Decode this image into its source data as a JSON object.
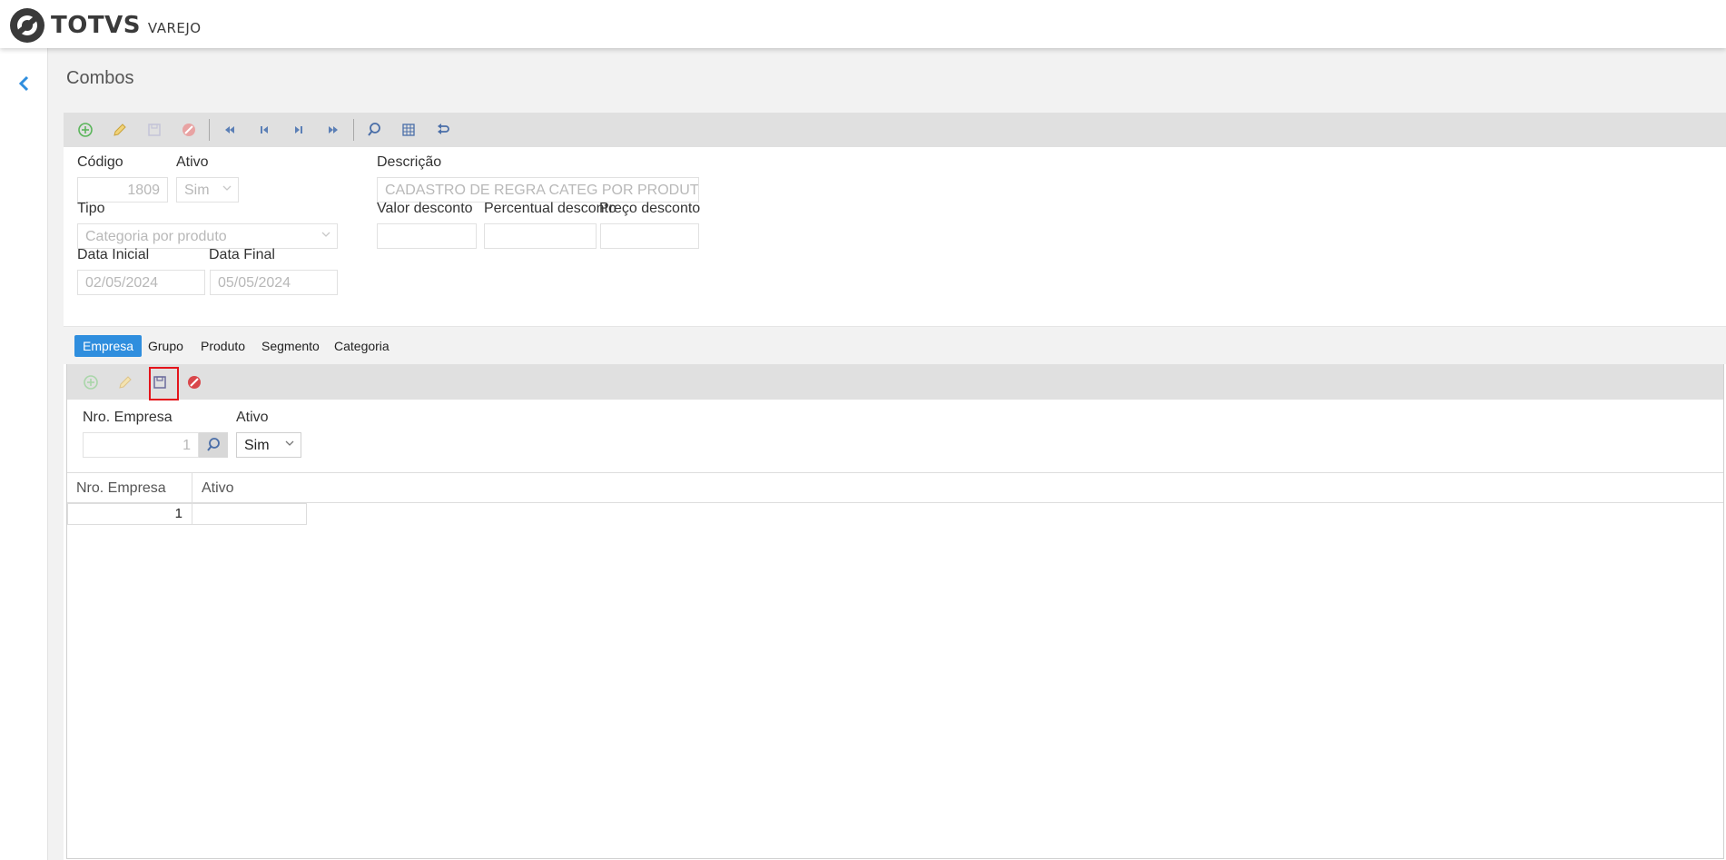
{
  "app": {
    "brand": "TOTVS",
    "product": "VAREJO"
  },
  "page": {
    "title": "Combos"
  },
  "toolbar": {
    "buttons": [
      "add-icon",
      "edit-icon",
      "save-icon",
      "cancel-icon",
      "first-icon",
      "previous-icon",
      "next-icon",
      "last-icon",
      "search-icon",
      "grid-icon",
      "undo-icon"
    ]
  },
  "form": {
    "codigo": {
      "label": "Código",
      "value": "1809"
    },
    "ativo": {
      "label": "Ativo",
      "value": "Sim"
    },
    "descricao": {
      "label": "Descrição",
      "value": "CADASTRO DE REGRA CATEG POR PRODUTO"
    },
    "tipo": {
      "label": "Tipo",
      "value": "Categoria por produto"
    },
    "valor_desconto": {
      "label": "Valor desconto",
      "value": ""
    },
    "percentual_desconto": {
      "label": "Percentual desconto",
      "value": ""
    },
    "preco_desconto": {
      "label": "Preço desconto",
      "value": ""
    },
    "data_inicial": {
      "label": "Data Inicial",
      "value": "02/05/2024"
    },
    "data_final": {
      "label": "Data Final",
      "value": "05/05/2024"
    }
  },
  "tabs": [
    "Empresa",
    "Grupo",
    "Produto",
    "Segmento",
    "Categoria"
  ],
  "active_tab": "Empresa",
  "subform": {
    "nro_empresa": {
      "label": "Nro. Empresa",
      "value": "1"
    },
    "ativo": {
      "label": "Ativo",
      "value": "Sim"
    }
  },
  "grid": {
    "columns": [
      "Nro. Empresa",
      "Ativo"
    ],
    "rows": [
      {
        "nro_empresa": "1",
        "ativo": ""
      }
    ]
  },
  "colors": {
    "accent": "#2f8ede",
    "toolbar_bg": "#e0e0e0",
    "highlight_box": "#e4141b"
  }
}
